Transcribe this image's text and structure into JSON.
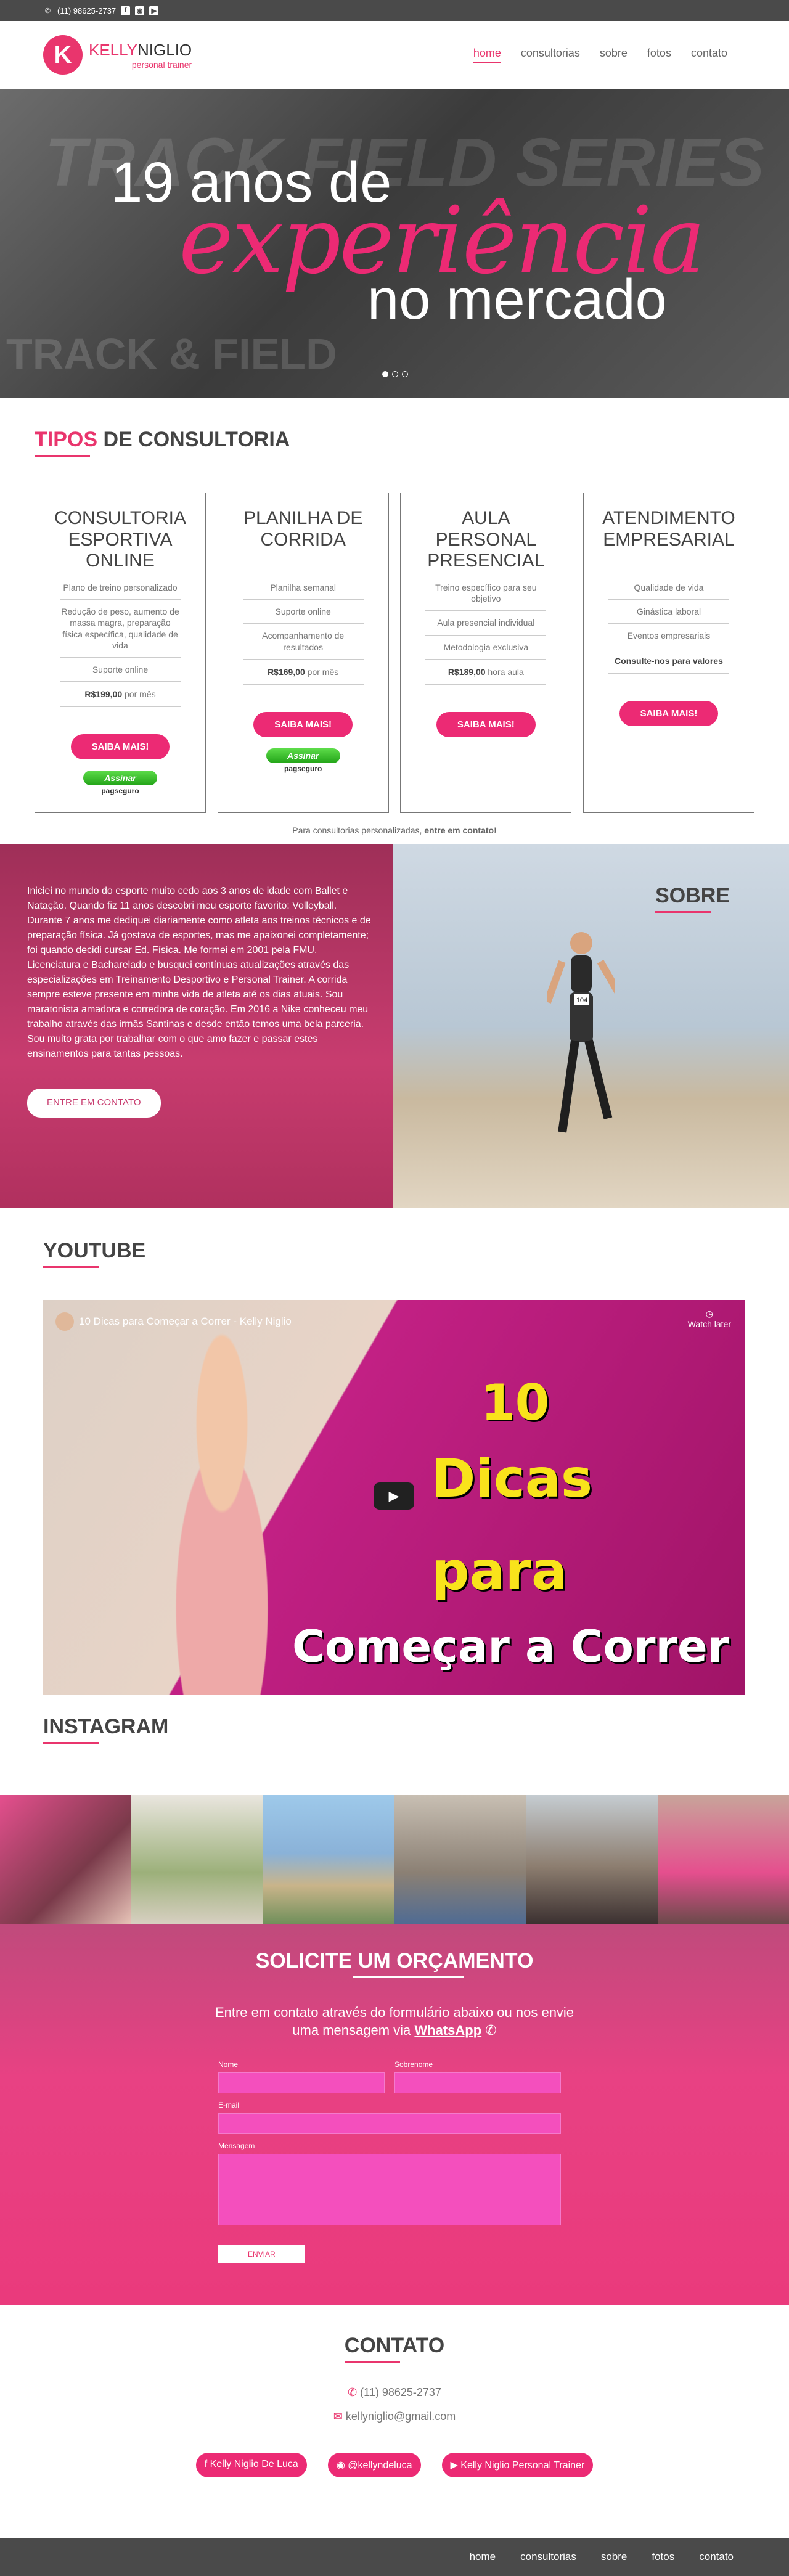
{
  "topbar": {
    "phone": "(11) 98625-2737",
    "icons": [
      "facebook-icon",
      "instagram-icon",
      "youtube-icon"
    ]
  },
  "header": {
    "logo_letter": "K",
    "logo_first": "KELLY",
    "logo_last": "NIGLIO",
    "logo_sub": "personal trainer",
    "nav": [
      "home",
      "consultorias",
      "sobre",
      "fotos",
      "contato"
    ]
  },
  "hero": {
    "line1": "19 anos de",
    "line2": "experiência",
    "line3": "no mercado",
    "bg1": "TRACK FIELD SERIES",
    "bg2": "TRACK & FIELD"
  },
  "tipos": {
    "title_a": "TIPOS",
    "title_b": " DE CONSULTORIA",
    "cards": [
      {
        "title": "CONSULTORIA ESPORTIVA ONLINE",
        "features": [
          "Plano de treino personalizado",
          "Redução de peso, aumento de massa magra, preparação física específica, qualidade de vida",
          "Suporte online"
        ],
        "price": "R$199,00",
        "period": "por mês",
        "button": "SAIBA MAIS!"
      },
      {
        "title": "PLANILHA DE CORRIDA",
        "features": [
          "Planilha semanal",
          "Suporte online",
          "Acompanhamento de resultados"
        ],
        "price": "R$169,00",
        "period": "por mês",
        "button": "SAIBA MAIS!"
      },
      {
        "title": "AULA PERSONAL PRESENCIAL",
        "features": [
          "Treino específico para seu objetivo",
          "Aula presencial individual",
          "Metodologia exclusiva"
        ],
        "price": "R$189,00",
        "period": "hora aula",
        "button": "SAIBA MAIS!"
      },
      {
        "title": "ATENDIMENTO EMPRESARIAL",
        "features": [
          "Qualidade de vida",
          "Ginástica laboral",
          "Eventos empresariais"
        ],
        "price": "Consulte-nos para valores",
        "period": "",
        "button": "SAIBA MAIS!"
      }
    ],
    "pay_button": "Assinar",
    "pay_brand": "pagseguro",
    "note_a": "Para consultorias personalizadas, ",
    "note_b": "entre em contato!"
  },
  "sobre": {
    "title": "SOBRE",
    "text": "Iniciei no mundo do esporte muito cedo aos 3 anos de idade com Ballet e Natação. Quando fiz 11 anos descobri meu esporte favorito: Volleyball. Durante 7 anos me dediquei diariamente como atleta aos treinos técnicos e de preparação física. Já gostava de esportes, mas me apaixonei completamente; foi quando decidi cursar Ed. Física. Me formei em 2001 pela FMU, Licenciatura e Bacharelado e busquei contínuas atualizações através das especializações em Treinamento Desportivo e Personal Trainer.  A corrida sempre esteve presente em minha vida de atleta até os dias atuais. Sou maratonista amadora e corredora de coração. Em 2016 a Nike conheceu meu trabalho através das irmãs Santinas e desde então temos uma bela parceria. Sou muito grata por trabalhar com o que amo fazer e passar estes ensinamentos para tantas pessoas.",
    "button": "ENTRE EM CONTATO",
    "bib": "104"
  },
  "youtube": {
    "title": "YOUTUBE",
    "video_title": "10 Dicas para Começar a Correr - Kelly Niglio",
    "watch_later": "Watch later",
    "t1": "10",
    "t2": "Dicas",
    "t3": "para",
    "t4": "Começar a Correr"
  },
  "instagram": {
    "title": "INSTAGRAM"
  },
  "orcamento": {
    "title": "SOLICITE UM ORÇAMENTO",
    "sub_a": "Entre em contato através do formulário abaixo ou nos envie",
    "sub_b": "uma mensagem via ",
    "sub_link": "WhatsApp",
    "name_label": "Nome",
    "surname_label": "Sobrenome",
    "email_label": "E-mail",
    "message_label": "Mensagem",
    "send": "ENVIAR"
  },
  "contato": {
    "title": "CONTATO",
    "phone": "(11) 98625-2737",
    "email": "kellyniglio@gmail.com",
    "socials": [
      "Kelly Niglio De Luca",
      "@kellyndeluca",
      "Kelly Niglio Personal Trainer"
    ]
  },
  "footer": {
    "nav": [
      "home",
      "consultorias",
      "sobre",
      "fotos",
      "contato"
    ]
  },
  "colors": {
    "accent": "#ec2a74",
    "dark": "#4a4a4a"
  }
}
